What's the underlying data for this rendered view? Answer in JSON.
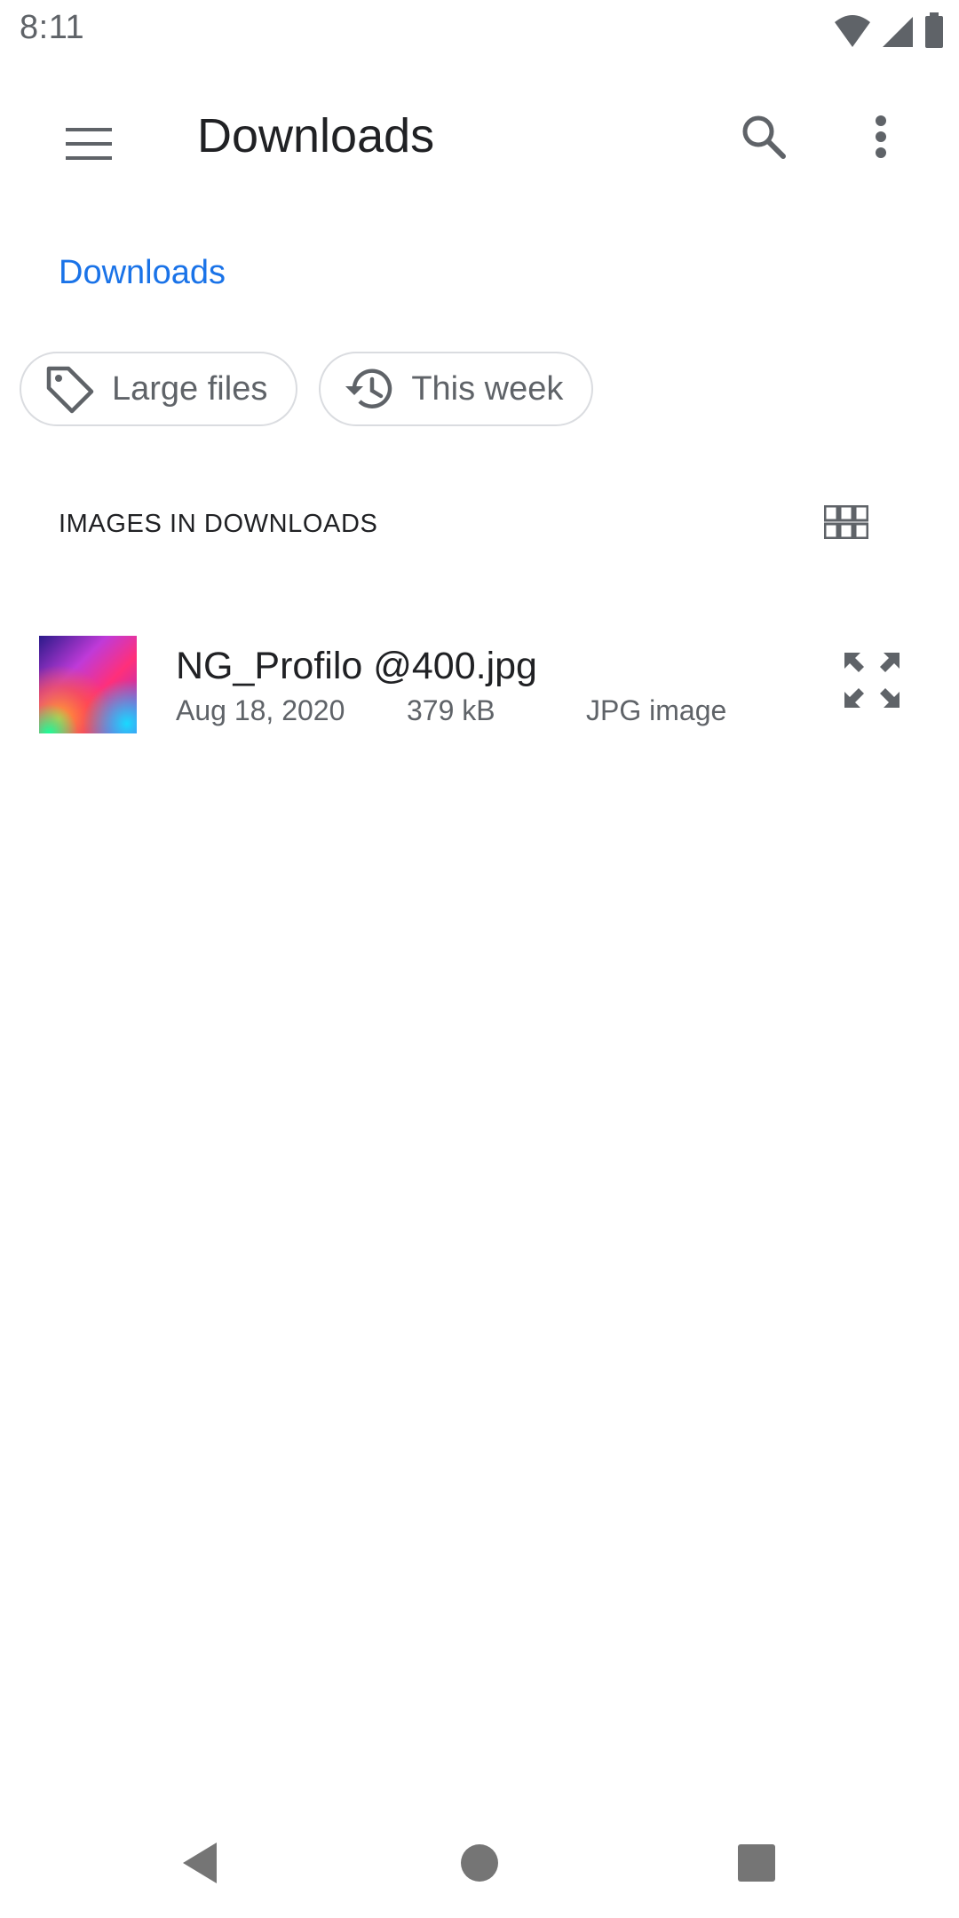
{
  "status_bar": {
    "time": "8:11",
    "icons": [
      "wifi-icon",
      "cell-signal-icon",
      "battery-icon"
    ]
  },
  "app_bar": {
    "title": "Downloads",
    "icons": [
      "menu-icon",
      "search-icon",
      "more-vert-icon"
    ]
  },
  "breadcrumb": {
    "label": "Downloads",
    "color": "#1a73e8"
  },
  "chips": [
    {
      "label": "Large files",
      "icon": "tag-icon"
    },
    {
      "label": "This week",
      "icon": "history-icon"
    }
  ],
  "section": {
    "header": "IMAGES IN DOWNLOADS",
    "view_toggle_icon": "grid-view-icon"
  },
  "files": [
    {
      "name": "NG_Profilo @400.jpg",
      "date": "Aug 18, 2020",
      "size": "379 kB",
      "type": "JPG image",
      "action_icon": "expand-icon"
    }
  ],
  "nav_bar": {
    "icons": [
      "back-icon",
      "home-icon",
      "recents-icon"
    ]
  }
}
